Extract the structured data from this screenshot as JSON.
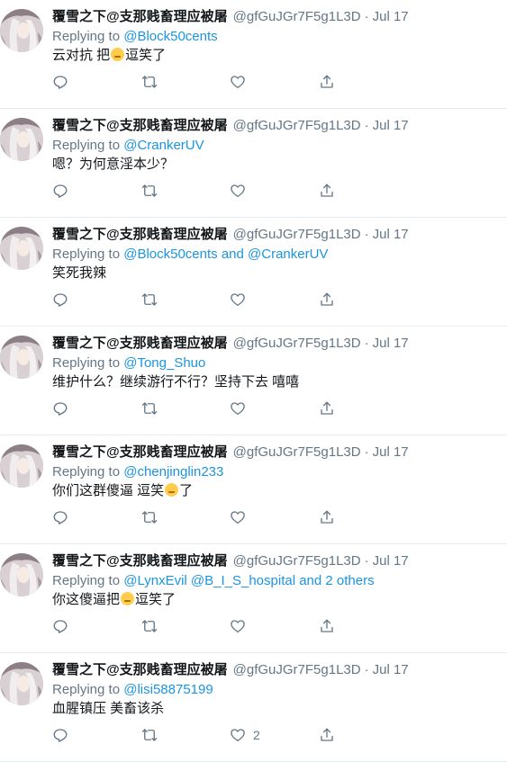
{
  "author": {
    "name": "覆雪之下@支那贱畜理应被屠",
    "handle": "@gfGuJGr7F5g1L3D",
    "separator": "·"
  },
  "reply_prefix": "Replying to",
  "icons": {
    "reply": "reply-icon",
    "retweet": "retweet-icon",
    "like": "like-icon",
    "share": "share-icon",
    "emoji": "unamused-face-emoji"
  },
  "colors": {
    "link": "#1b95e0",
    "muted": "#657786",
    "text": "#14171a",
    "divider": "#e6ecf0"
  },
  "tweets": [
    {
      "date": "Jul 17",
      "reply_to": "@Block50cents",
      "text_parts": [
        "云对抗  把",
        "逗笑了"
      ],
      "like_count": ""
    },
    {
      "date": "Jul 17",
      "reply_to": "@CrankerUV",
      "text_parts": [
        "嗯？为何意淫本少？"
      ],
      "like_count": ""
    },
    {
      "date": "Jul 17",
      "reply_to": "@Block50cents and @CrankerUV",
      "text_parts": [
        "笑死我辣"
      ],
      "like_count": ""
    },
    {
      "date": "Jul 17",
      "reply_to": "@Tong_Shuo",
      "text_parts": [
        "维护什么？继续游行不行？坚持下去 嘻嘻"
      ],
      "like_count": ""
    },
    {
      "date": "Jul 17",
      "reply_to": "@chenjinglin233",
      "text_parts": [
        "你们这群傻逼 逗笑",
        "了"
      ],
      "like_count": ""
    },
    {
      "date": "Jul 17",
      "reply_to": "@LynxEvil @B_I_S_hospital and 2 others",
      "text_parts": [
        "你这傻逼把",
        "逗笑了"
      ],
      "like_count": ""
    },
    {
      "date": "Jul 17",
      "reply_to": "@lisi58875199",
      "text_parts": [
        "血腥镇压 美畜该杀"
      ],
      "like_count": "2"
    }
  ]
}
